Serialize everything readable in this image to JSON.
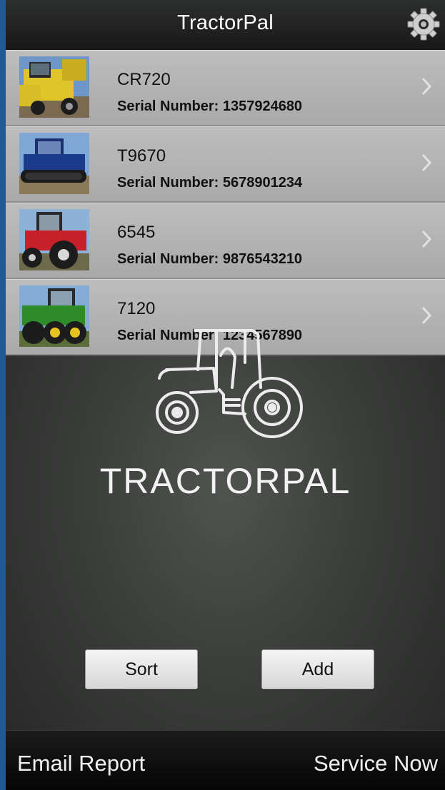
{
  "app": {
    "title": "TractorPal",
    "settings_icon": "gear-icon"
  },
  "colors": {
    "frame": "#1f5a96",
    "row_background": "#b5b5b5",
    "navbar": "#222322"
  },
  "equipment": [
    {
      "model": "CR720",
      "serial_label": "Serial Number:",
      "serial": "1357924680",
      "image": "yellow-combine-photo"
    },
    {
      "model": "T9670",
      "serial_label": "Serial Number:",
      "serial": "5678901234",
      "image": "blue-track-tractor-photo"
    },
    {
      "model": "6545",
      "serial_label": "Serial Number:",
      "serial": "9876543210",
      "image": "red-tractor-photo"
    },
    {
      "model": "7120",
      "serial_label": "Serial Number:",
      "serial": "1234567890",
      "image": "green-tractor-photo"
    }
  ],
  "brand": {
    "name": "TRACTORPAL",
    "logo": "tractor-outline-logo"
  },
  "buttons": {
    "sort": "Sort",
    "add": "Add"
  },
  "tabbar": {
    "email_report": "Email Report",
    "service_now": "Service Now"
  }
}
